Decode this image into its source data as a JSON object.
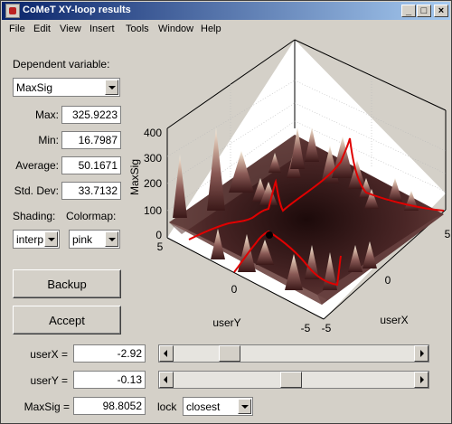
{
  "window": {
    "title": "CoMeT XY-loop results",
    "minimize": "_",
    "maximize": "□",
    "close": "×"
  },
  "menu": [
    "File",
    "Edit",
    "View",
    "Insert",
    "Tools",
    "Window",
    "Help"
  ],
  "panel": {
    "dependent_label": "Dependent variable:",
    "dependent_value": "MaxSig",
    "max_label": "Max:",
    "max_value": "325.9223",
    "min_label": "Min:",
    "min_value": "16.7987",
    "avg_label": "Average:",
    "avg_value": "50.1671",
    "std_label": "Std. Dev:",
    "std_value": "33.7132",
    "shading_label": "Shading:",
    "shading_value": "interp",
    "colormap_label": "Colormap:",
    "colormap_value": "pink",
    "backup_label": "Backup",
    "accept_label": "Accept"
  },
  "plot": {
    "zlabel": "MaxSig",
    "ylabel": "userY",
    "xlabel": "userX",
    "z_ticks": [
      "0",
      "100",
      "200",
      "300",
      "400"
    ],
    "y_ticks": [
      "5",
      "0",
      "-5"
    ],
    "x_ticks": [
      "-5",
      "0",
      "5"
    ],
    "marker_color": "#000000",
    "line_color": "#e00000"
  },
  "controls": {
    "userx_label": "userX =",
    "userx_value": "-2.92",
    "usery_label": "userY =",
    "usery_value": "-0.13",
    "maxsig_label": "MaxSig =",
    "maxsig_value": "98.8052",
    "lock_label": "lock",
    "lock_value": "closest",
    "userx_slider_fraction": 0.208,
    "usery_slider_fraction": 0.487
  }
}
